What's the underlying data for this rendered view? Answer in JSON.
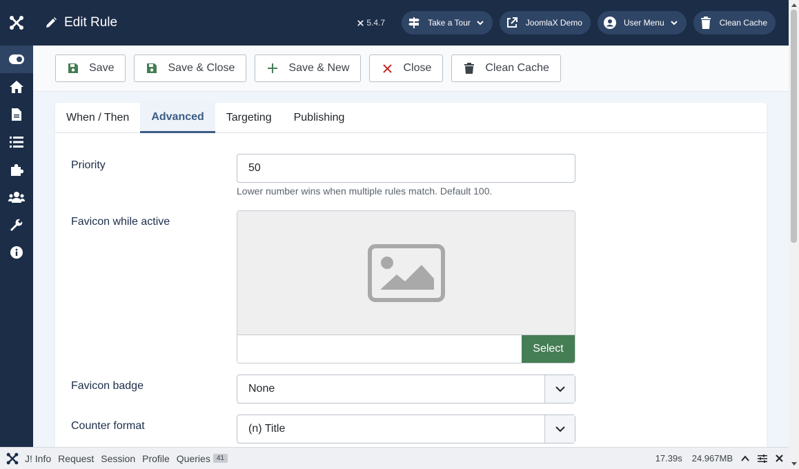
{
  "header": {
    "title": "Edit Rule",
    "version": "5.4.7",
    "buttons": [
      {
        "label": "Take a Tour",
        "icon": "signpost-icon"
      },
      {
        "label": "JoomlaX Demo",
        "icon": "external-link-icon"
      },
      {
        "label": "User Menu",
        "icon": "user-icon"
      },
      {
        "label": "Clean Cache",
        "icon": "trash-icon"
      }
    ]
  },
  "sidebar": {
    "items": [
      {
        "icon": "toggle-icon",
        "active": true
      },
      {
        "icon": "home-icon"
      },
      {
        "icon": "file-icon"
      },
      {
        "icon": "list-icon"
      },
      {
        "icon": "puzzle-icon"
      },
      {
        "icon": "users-icon"
      },
      {
        "icon": "wrench-icon"
      },
      {
        "icon": "info-icon"
      }
    ]
  },
  "toolbar": {
    "save": "Save",
    "save_close": "Save & Close",
    "save_new": "Save & New",
    "close": "Close",
    "clean_cache": "Clean Cache"
  },
  "tabs": [
    {
      "label": "When / Then"
    },
    {
      "label": "Advanced",
      "active": true
    },
    {
      "label": "Targeting"
    },
    {
      "label": "Publishing"
    }
  ],
  "form": {
    "priority": {
      "label": "Priority",
      "value": "50",
      "help": "Lower number wins when multiple rules match. Default 100."
    },
    "favicon": {
      "label": "Favicon while active",
      "select_label": "Select"
    },
    "badge": {
      "label": "Favicon badge",
      "value": "None"
    },
    "counter": {
      "label": "Counter format",
      "value": "(n) Title"
    }
  },
  "debugbar": {
    "info": "J! Info",
    "request": "Request",
    "session": "Session",
    "profile": "Profile",
    "queries": "Queries",
    "queries_count": "41",
    "time": "17.39s",
    "memory": "24.967MB"
  },
  "colors": {
    "header_bg": "#1c2d48",
    "accent": "#3b5c86",
    "select_button": "#457d54",
    "close_icon": "#c52827"
  }
}
